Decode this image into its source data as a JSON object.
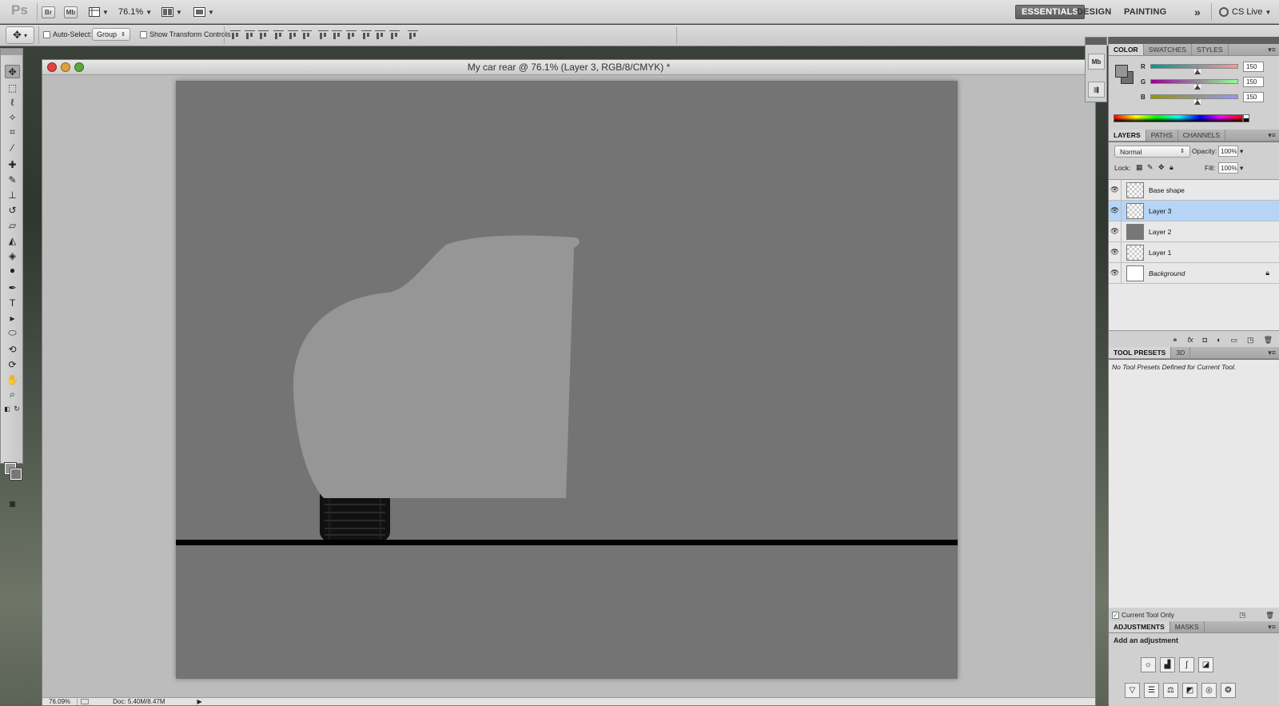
{
  "app": {
    "logo": "Ps"
  },
  "appbar": {
    "bridge_label": "Br",
    "minibridge_label": "Mb",
    "zoom": "76.1%",
    "workspaces": [
      "ESSENTIALS",
      "DESIGN",
      "PAINTING"
    ],
    "more": "»",
    "cslive": "CS Live"
  },
  "options": {
    "auto_select_label": "Auto-Select:",
    "auto_select_value": "Group",
    "show_transform_label": "Show Transform Controls"
  },
  "document": {
    "title": "My car rear @ 76.1% (Layer 3, RGB/8/CMYK) *",
    "status_zoom": "76.09%",
    "status_doc": "Doc: 5.40M/8.47M"
  },
  "color_panel": {
    "tabs": [
      "COLOR",
      "SWATCHES",
      "STYLES"
    ],
    "channels": [
      {
        "label": "R",
        "value": "150",
        "gradient": "linear-gradient(90deg,#009696,#ff9696)"
      },
      {
        "label": "G",
        "value": "150",
        "gradient": "linear-gradient(90deg,#960096,#96ff96)"
      },
      {
        "label": "B",
        "value": "150",
        "gradient": "linear-gradient(90deg,#969600,#9696ff)"
      }
    ],
    "foreground": "#969696",
    "background": "#6f6f6f"
  },
  "layers_panel": {
    "tabs": [
      "LAYERS",
      "PATHS",
      "CHANNELS"
    ],
    "blend_mode": "Normal",
    "opacity_label": "Opacity:",
    "opacity_value": "100%",
    "lock_label": "Lock:",
    "fill_label": "Fill:",
    "fill_value": "100%",
    "layers": [
      {
        "name": "Base shape",
        "selected": false,
        "thumb": "checker"
      },
      {
        "name": "Layer 3",
        "selected": true,
        "thumb": "checker"
      },
      {
        "name": "Layer 2",
        "selected": false,
        "thumb": "gray"
      },
      {
        "name": "Layer 1",
        "selected": false,
        "thumb": "checker"
      },
      {
        "name": "Background",
        "selected": false,
        "thumb": "white",
        "locked": true
      }
    ]
  },
  "presets_panel": {
    "tabs": [
      "TOOL PRESETS",
      "3D"
    ],
    "message": "No Tool Presets Defined for Current Tool.",
    "current_tool_only": "Current Tool Only"
  },
  "adjustments_panel": {
    "tabs": [
      "ADJUSTMENTS",
      "MASKS"
    ],
    "heading": "Add an adjustment"
  },
  "canvas": {
    "background_color": "#747474",
    "car_body_color": "#969696"
  }
}
